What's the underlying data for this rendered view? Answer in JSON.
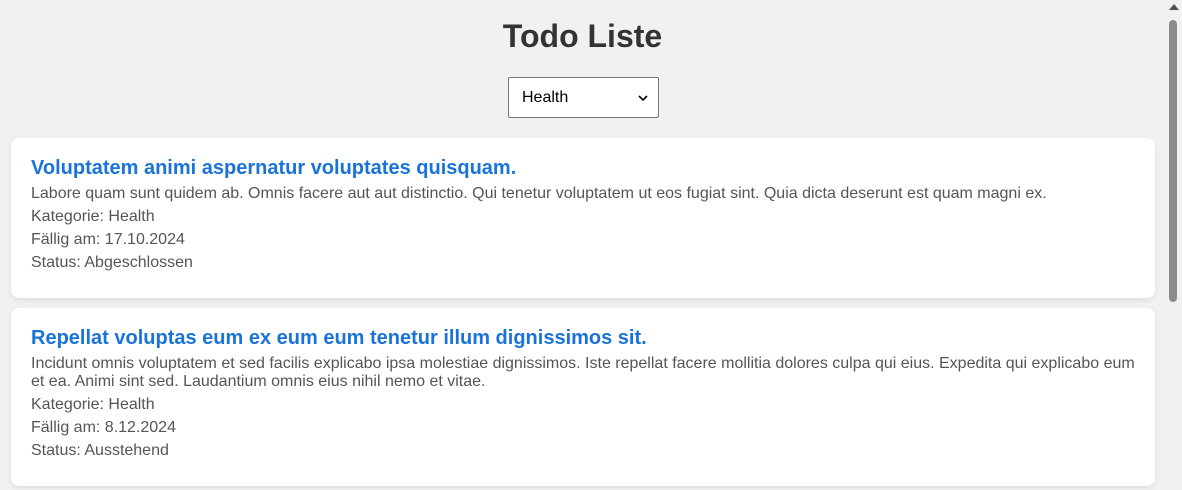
{
  "header": {
    "title": "Todo Liste"
  },
  "filter": {
    "selected": "Health"
  },
  "todos": [
    {
      "title": "Voluptatem animi aspernatur voluptates quisquam.",
      "description": "Labore quam sunt quidem ab. Omnis facere aut aut distinctio. Qui tenetur voluptatem ut eos fugiat sint. Quia dicta deserunt est quam magni ex.",
      "category": "Kategorie: Health",
      "due": "Fällig am: 17.10.2024",
      "status": "Status: Abgeschlossen"
    },
    {
      "title": "Repellat voluptas eum ex eum eum tenetur illum dignissimos sit.",
      "description": "Incidunt omnis voluptatem et sed facilis explicabo ipsa molestiae dignissimos. Iste repellat facere mollitia dolores culpa qui eius. Expedita qui explicabo eum et ea. Animi sint sed. Laudantium omnis eius nihil nemo et vitae.",
      "category": "Kategorie: Health",
      "due": "Fällig am: 8.12.2024",
      "status": "Status: Ausstehend"
    }
  ]
}
